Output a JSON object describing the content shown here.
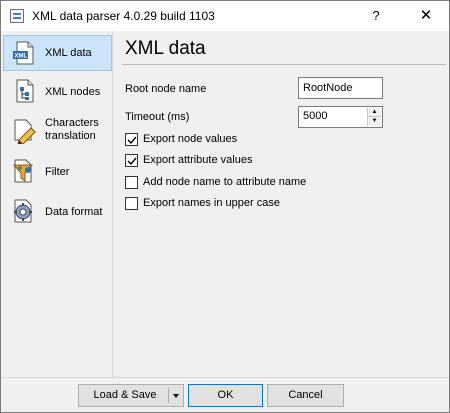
{
  "window": {
    "title": "XML data parser 4.0.29 build 1103",
    "help_label": "?",
    "close_label": "✕"
  },
  "sidebar": {
    "items": [
      {
        "label": "XML data",
        "icon": "xml-document-icon",
        "selected": true
      },
      {
        "label": "XML nodes",
        "icon": "xml-tree-icon",
        "selected": false
      },
      {
        "label_line1": "Characters",
        "label_line2": "translation",
        "icon": "pencil-icon",
        "selected": false
      },
      {
        "label": "Filter",
        "icon": "funnel-icon",
        "selected": false
      },
      {
        "label": "Data format",
        "icon": "gear-icon",
        "selected": false
      }
    ]
  },
  "main": {
    "title": "XML data",
    "root_node_label": "Root node name",
    "root_node_value": "RootNode",
    "timeout_label": "Timeout (ms)",
    "timeout_value": "5000",
    "options": [
      {
        "label": "Export node values",
        "checked": true
      },
      {
        "label": "Export attribute values",
        "checked": true
      },
      {
        "label": "Add node name to attribute name",
        "checked": false
      },
      {
        "label": "Export names in upper case",
        "checked": false
      }
    ]
  },
  "buttons": {
    "load_save": "Load & Save",
    "ok": "OK",
    "cancel": "Cancel"
  },
  "colors": {
    "selected_background": "#cce4f7",
    "selected_border": "#99c9ef",
    "default_button_border": "#0078d7"
  }
}
